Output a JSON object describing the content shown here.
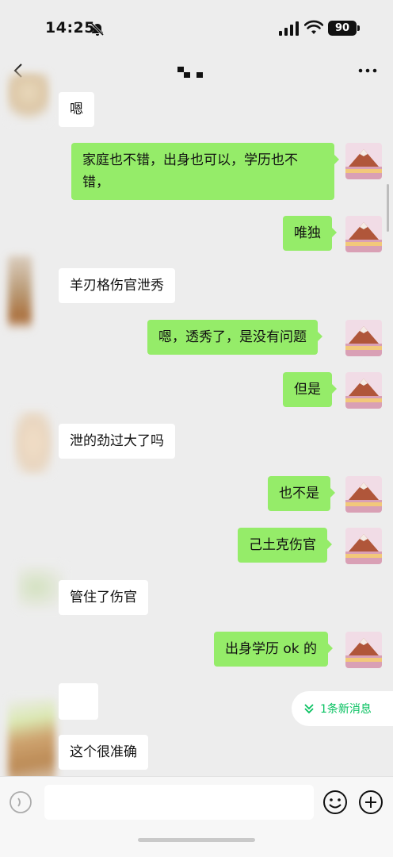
{
  "status_bar": {
    "time": "14:25",
    "battery": "90"
  },
  "nav": {
    "title_obscured": true
  },
  "messages": [
    {
      "side": "in",
      "text": "嗯"
    },
    {
      "side": "out",
      "text": "家庭也不错，出身也可以，学历也不\n错，"
    },
    {
      "side": "out",
      "text": "唯独"
    },
    {
      "side": "in",
      "text": "羊刃格伤官泄秀"
    },
    {
      "side": "out",
      "text": "嗯，透秀了，是没有问题"
    },
    {
      "side": "out",
      "text": "但是"
    },
    {
      "side": "in",
      "text": "泄的劲过大了吗"
    },
    {
      "side": "out",
      "text": "也不是"
    },
    {
      "side": "out",
      "text": "己土克伤官"
    },
    {
      "side": "in",
      "text": "管住了伤官"
    },
    {
      "side": "out",
      "text": "出身学历 ok 的"
    },
    {
      "side": "in",
      "text": "",
      "emoji": "laughing-tears"
    },
    {
      "side": "in",
      "text": "这个很准确"
    }
  ],
  "new_message_pill": {
    "label": "1条新消息"
  },
  "input": {
    "placeholder": ""
  },
  "colors": {
    "outgoing_bubble": "#95ec69",
    "incoming_bubble": "#ffffff",
    "background": "#ededed",
    "accent": "#07c160"
  }
}
